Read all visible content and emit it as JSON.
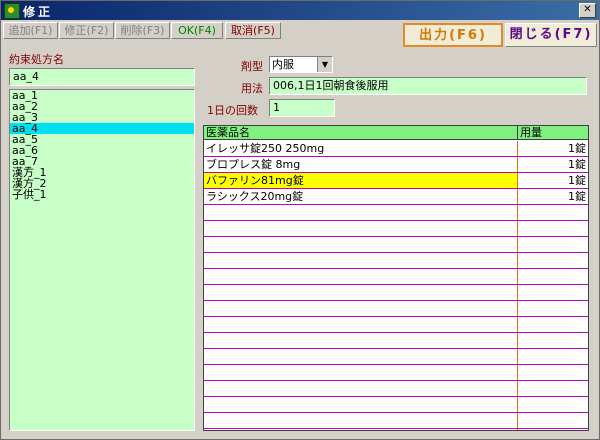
{
  "window": {
    "title": "修正"
  },
  "toolbar": {
    "add": "追加(F1)",
    "edit": "修正(F2)",
    "delete": "削除(F3)",
    "ok": "OK(F4)",
    "cancel": "取消(F5)"
  },
  "actions": {
    "output": "出力(F6)",
    "close": "閉じる(F7)"
  },
  "left": {
    "name_label": "約束処方名",
    "name_value": "aa_4",
    "items": [
      "aa_1",
      "aa_2",
      "aa_3",
      "aa_4",
      "aa_5",
      "aa_6",
      "aa_7",
      "漢方_1",
      "漢方_2",
      "子供_1"
    ],
    "selected_index": 3
  },
  "form": {
    "dosage_form_label": "剤型",
    "dosage_form_value": "内服",
    "usage_label": "用法",
    "usage_value": "006,1日1回朝食後服用",
    "times_label": "1日の回数",
    "times_value": "1"
  },
  "grid": {
    "headers": [
      "医薬品名",
      "用量"
    ],
    "rows": [
      [
        "イレッサ錠250 250mg",
        "1錠"
      ],
      [
        "ブロプレス錠 8mg",
        "1錠"
      ],
      [
        "バファリン81mg錠",
        "1錠"
      ],
      [
        "ラシックス20mg錠",
        "1錠"
      ]
    ],
    "highlighted_row": 2,
    "empty_rows": 15
  },
  "colors": {
    "field_bg": "#c8ffc8",
    "header_bg": "#80f080",
    "selection": "#00e0f0",
    "row_highlight": "#ffff00"
  }
}
